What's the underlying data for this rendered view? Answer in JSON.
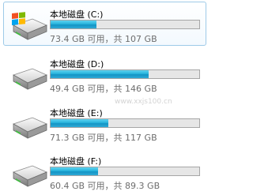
{
  "drives": [
    {
      "name": "本地磁盘 (C:)",
      "info": "73.4 GB 可用，共 107 GB",
      "used_fraction": 0.31,
      "icon": "windows-system-drive-icon",
      "selected": true
    },
    {
      "name": "本地磁盘 (D:)",
      "info": "49.4 GB 可用，共 146 GB",
      "used_fraction": 0.66,
      "icon": "hard-drive-icon",
      "selected": false
    },
    {
      "name": "本地磁盘 (E:)",
      "info": "71.3 GB 可用，共 117 GB",
      "used_fraction": 0.39,
      "icon": "hard-drive-icon",
      "selected": false
    },
    {
      "name": "本地磁盘 (F:)",
      "info": "60.4 GB 可用，共 89.3 GB",
      "used_fraction": 0.32,
      "icon": "hard-drive-icon",
      "selected": false
    }
  ],
  "watermark": "www.xxjs100.cn",
  "colors": {
    "bar_fill": "#26b0dc",
    "selection_border": "#9ecae8",
    "info_text": "#6d6d6d"
  }
}
